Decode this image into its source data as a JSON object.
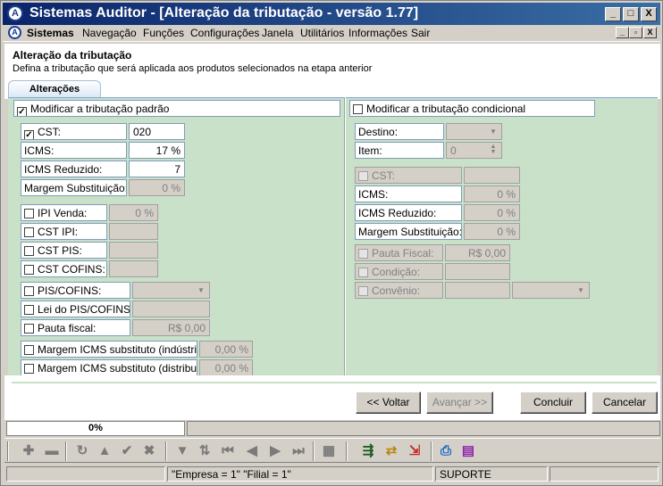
{
  "window": {
    "title": "Sistemas Auditor - [Alteração da tributação - versão 1.77]",
    "app_icon": "A"
  },
  "caption_buttons": {
    "minimize": "_",
    "maximize": "□",
    "close": "X"
  },
  "menu": {
    "items": [
      "Sistemas",
      "Navegação",
      "Funções",
      "Configurações",
      "Janela",
      "Utilitários",
      "Informações",
      "Sair"
    ],
    "mdi_buttons": [
      "_",
      "▫",
      "X"
    ]
  },
  "header": {
    "title": "Alteração da tributação",
    "subtitle": "Defina a tributação que será aplicada aos produtos selecionados na etapa anterior"
  },
  "tab": {
    "label": "Alterações"
  },
  "left": {
    "group_label": "Modificar a tributação padrão",
    "group_checked": true,
    "cst": {
      "label": "CST:",
      "value": "020",
      "checked": true
    },
    "icms": {
      "label": "ICMS:",
      "value": "17 %"
    },
    "icms_reduzido": {
      "label": "ICMS Reduzido:",
      "value": "7"
    },
    "margem": {
      "label": "Margem Substituição:",
      "value": "0 %"
    },
    "ipi_venda": {
      "label": "IPI Venda:",
      "value": "0 %"
    },
    "cst_ipi": {
      "label": "CST IPI:",
      "value": ""
    },
    "cst_pis": {
      "label": "CST PIS:",
      "value": ""
    },
    "cst_cofins": {
      "label": "CST COFINS:",
      "value": ""
    },
    "pis_cofins": {
      "label": "PIS/COFINS:",
      "value": ""
    },
    "lei_pis": {
      "label": "Lei do PIS/COFINS:",
      "value": ""
    },
    "pauta": {
      "label": "Pauta fiscal:",
      "value": "R$ 0,00"
    },
    "margem_ind": {
      "label": "Margem ICMS substituto (indústria):",
      "value": "0,00 %"
    },
    "margem_dist": {
      "label": "Margem ICMS substituto (distribuidora)",
      "value": "0,00 %"
    }
  },
  "right": {
    "group_label": "Modificar a tributação condicional",
    "group_checked": false,
    "destino": {
      "label": "Destino:",
      "value": ""
    },
    "item": {
      "label": "Item:",
      "value": "0"
    },
    "cst": {
      "label": "CST:",
      "value": ""
    },
    "icms": {
      "label": "ICMS:",
      "value": "0 %"
    },
    "icms_reduzido": {
      "label": "ICMS Reduzido:",
      "value": "0 %"
    },
    "margem": {
      "label": "Margem Substituição:",
      "value": "0 %"
    },
    "pauta": {
      "label": "Pauta Fiscal:",
      "value": "R$ 0,00"
    },
    "condicao": {
      "label": "Condição:",
      "value": ""
    },
    "convenio": {
      "label": "Convênio:",
      "value": ""
    }
  },
  "buttons": {
    "voltar": "<< Voltar",
    "avancar": "Avançar >>",
    "concluir": "Concluir",
    "cancelar": "Cancelar"
  },
  "progress": {
    "label": "0%",
    "value": 0
  },
  "status": {
    "filter": "\"Empresa = 1\"   \"Filial = 1\"",
    "user": "SUPORTE"
  }
}
